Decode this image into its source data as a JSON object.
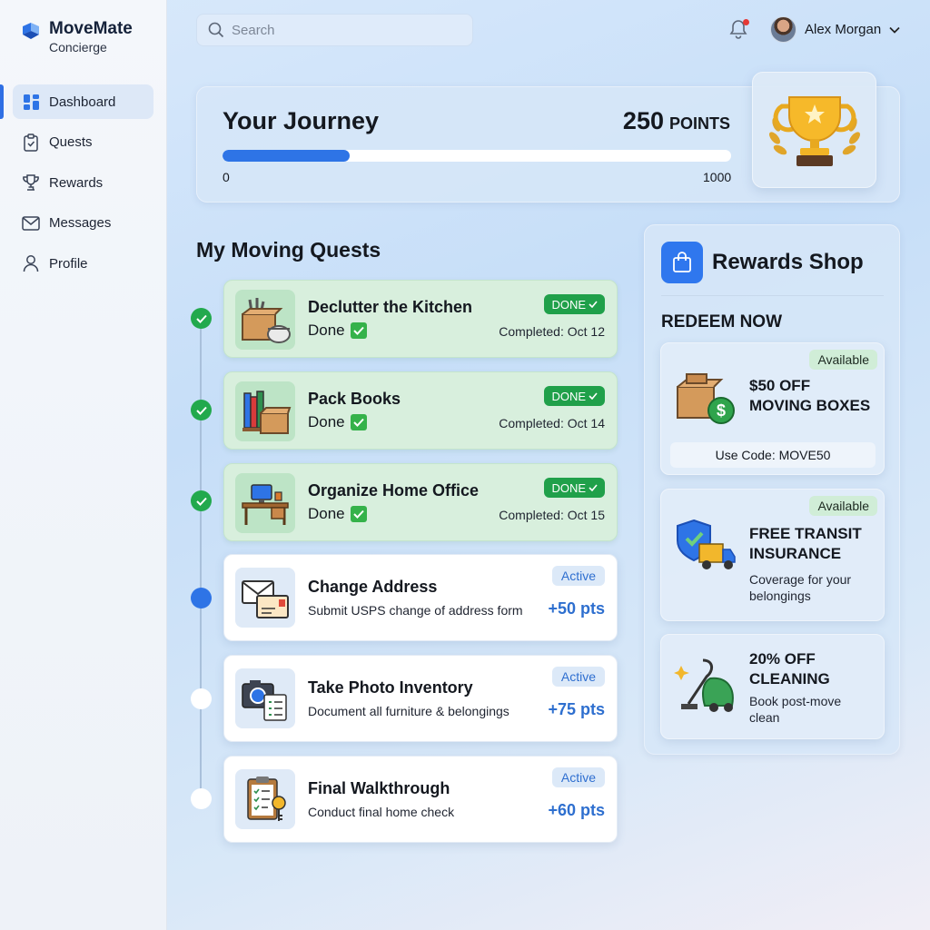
{
  "brand": {
    "name": "MoveMate",
    "subtitle": "Concierge"
  },
  "nav": {
    "items": [
      {
        "label": "Dashboard",
        "icon": "dashboard-icon",
        "active": true
      },
      {
        "label": "Quests",
        "icon": "clipboard-icon"
      },
      {
        "label": "Rewards",
        "icon": "trophy-icon"
      },
      {
        "label": "Messages",
        "icon": "mail-icon"
      },
      {
        "label": "Profile",
        "icon": "user-icon"
      }
    ]
  },
  "search": {
    "placeholder": "Search"
  },
  "user": {
    "name": "Alex Morgan"
  },
  "journey": {
    "title": "Your Journey",
    "points": "250",
    "points_label": "POINTS",
    "progress_min": "0",
    "progress_max": "1000",
    "progress_value": 250
  },
  "quests": {
    "title": "My Moving Quests",
    "items": [
      {
        "title": "Declutter the Kitchen",
        "status": "Done",
        "badge": "DONE",
        "date": "Completed: Oct 12",
        "icon": "kitchen-box-icon"
      },
      {
        "title": "Pack Books",
        "status": "Done",
        "badge": "DONE",
        "date": "Completed: Oct 14",
        "icon": "books-box-icon"
      },
      {
        "title": "Organize Home Office",
        "status": "Done",
        "badge": "DONE",
        "date": "Completed: Oct 15",
        "icon": "desk-icon"
      },
      {
        "title": "Change Address",
        "desc": "Submit USPS change of address form",
        "badge": "Active",
        "points": "+50 pts",
        "icon": "envelope-icon"
      },
      {
        "title": "Take Photo Inventory",
        "desc": "Document all furniture & belongings",
        "badge": "Active",
        "points": "+75 pts",
        "icon": "camera-icon"
      },
      {
        "title": "Final Walkthrough",
        "desc": "Conduct final home check",
        "badge": "Active",
        "points": "+60 pts",
        "icon": "clipboard-key-icon"
      }
    ]
  },
  "rewards": {
    "title": "Rewards Shop",
    "redeem_label": "REDEEM NOW",
    "items": [
      {
        "title_line1": "$50 OFF",
        "title_line2": "MOVING BOXES",
        "badge": "Available",
        "code": "Use Code: MOVE50",
        "icon": "box-dollar-icon"
      },
      {
        "title_line1": "FREE TRANSIT",
        "title_line2": "INSURANCE",
        "badge": "Available",
        "sub_line1": "Coverage for your",
        "sub_line2": "belongings",
        "icon": "shield-truck-icon"
      },
      {
        "title_line1": "20% OFF",
        "title_line2": "CLEANING",
        "sub_line1": "Book post-move",
        "sub_line2": "clean",
        "icon": "vacuum-icon"
      }
    ]
  },
  "colors": {
    "accent": "#2e74e6",
    "done_green": "#20a04a",
    "done_card": "#d8efdd",
    "active_text": "#2e6fcf"
  }
}
